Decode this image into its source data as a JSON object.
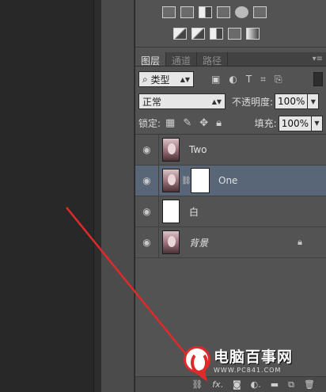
{
  "tabs": [
    {
      "label": "图层",
      "active": true
    },
    {
      "label": "通道",
      "active": false
    },
    {
      "label": "路径",
      "active": false
    }
  ],
  "filter": {
    "kind_label": "类型"
  },
  "blend": {
    "mode": "正常",
    "opacity_label": "不透明度:",
    "opacity_value": "100%"
  },
  "lock": {
    "label": "锁定:",
    "fill_label": "填充:",
    "fill_value": "100%"
  },
  "layers": [
    {
      "name": "Two",
      "thumb": "portrait",
      "selected": false
    },
    {
      "name": "One",
      "thumb": "portrait",
      "has_mask": true,
      "selected": true
    },
    {
      "name": "白",
      "thumb": "white",
      "selected": false
    },
    {
      "name": "背景",
      "thumb": "portrait",
      "locked": true,
      "italic": true,
      "selected": false
    }
  ],
  "watermark": {
    "title": "电脑百事网",
    "url": "WWW.PC841.COM"
  },
  "colors": {
    "panel": "#535353",
    "selected_row": "#596678",
    "annotation_arrow": "#e02a2a"
  }
}
